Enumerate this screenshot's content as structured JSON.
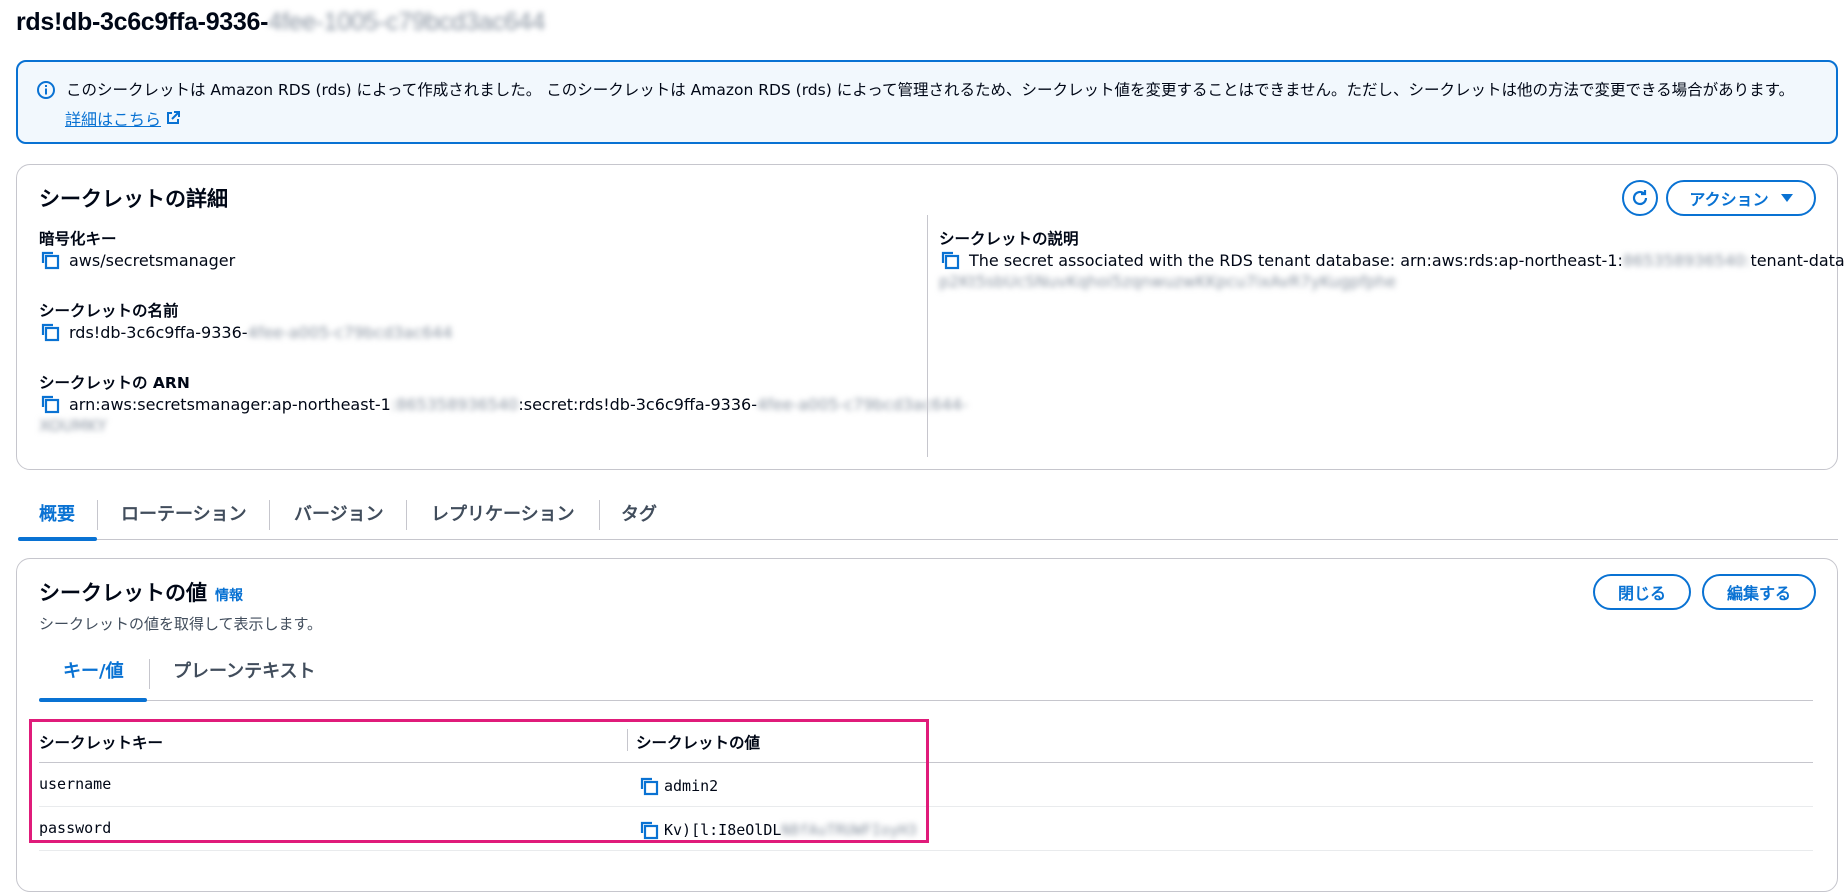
{
  "page_title": {
    "visible": "rds!db-3c6c9ffa-9336-",
    "blurred": "4fee-1005-c79bcd3ac644"
  },
  "banner": {
    "message": "このシークレットは Amazon RDS (rds) によって作成されました。 このシークレットは Amazon RDS (rds) によって管理されるため、シークレット値を変更することはできません。ただし、シークレットは他の方法で変更できる場合があります。",
    "link_label": "詳細はこちら",
    "icons": [
      "info-icon",
      "external-link-icon"
    ]
  },
  "details": {
    "title": "シークレットの詳細",
    "actions_label": "アクション",
    "encryption_key": {
      "label": "暗号化キー",
      "value": "aws/secretsmanager"
    },
    "secret_name": {
      "label": "シークレットの名前",
      "value": "rds!db-3c6c9ffa-9336-",
      "blurred": "4fee-a005-c79bcd3ac644"
    },
    "secret_arn": {
      "label": "シークレットの ARN",
      "value_a": "arn:aws:secretsmanager:ap-northeast-1",
      "blurred_a": ":865358936540",
      "value_b": ":secret:rds!db-3c6c9ffa-9336-",
      "blurred_b": "4fee-a005-c79bcd3ac644-",
      "blurred_c": "XOUMKY"
    },
    "secret_description": {
      "label": "シークレットの説明",
      "value_a": "The secret associated with the RDS tenant database: arn:aws:rds:ap-northeast-1:",
      "blurred_a": "865358936540:",
      "value_b": "tenant-database:tdb-",
      "blurred_b": "p2Kt5sbUcSNuvKqhoi5zqnwuzwKKpcu7ixAvR7yKugpfphe"
    }
  },
  "tabs": {
    "items": [
      "概要",
      "ローテーション",
      "バージョン",
      "レプリケーション",
      "タグ"
    ],
    "active_index": 0
  },
  "secret_value": {
    "title": "シークレットの値",
    "info_label": "情報",
    "description": "シークレットの値を取得して表示します。",
    "close_label": "閉じる",
    "edit_label": "編集する",
    "inner_tabs": [
      "キー/値",
      "プレーンテキスト"
    ],
    "active_inner_tab": 0,
    "columns": [
      "シークレットキー",
      "シークレットの値"
    ],
    "rows": [
      {
        "key": "username",
        "value": "admin2",
        "blurred": ""
      },
      {
        "key": "password",
        "value": "Kv)[l:I8eOlDL",
        "blurred": "N8fAuTRUWFIoyH3"
      }
    ]
  },
  "colors": {
    "accent": "#0972d3",
    "highlight": "#e01b7a",
    "banner_bg": "#f2f8fd",
    "text": "#000716"
  }
}
